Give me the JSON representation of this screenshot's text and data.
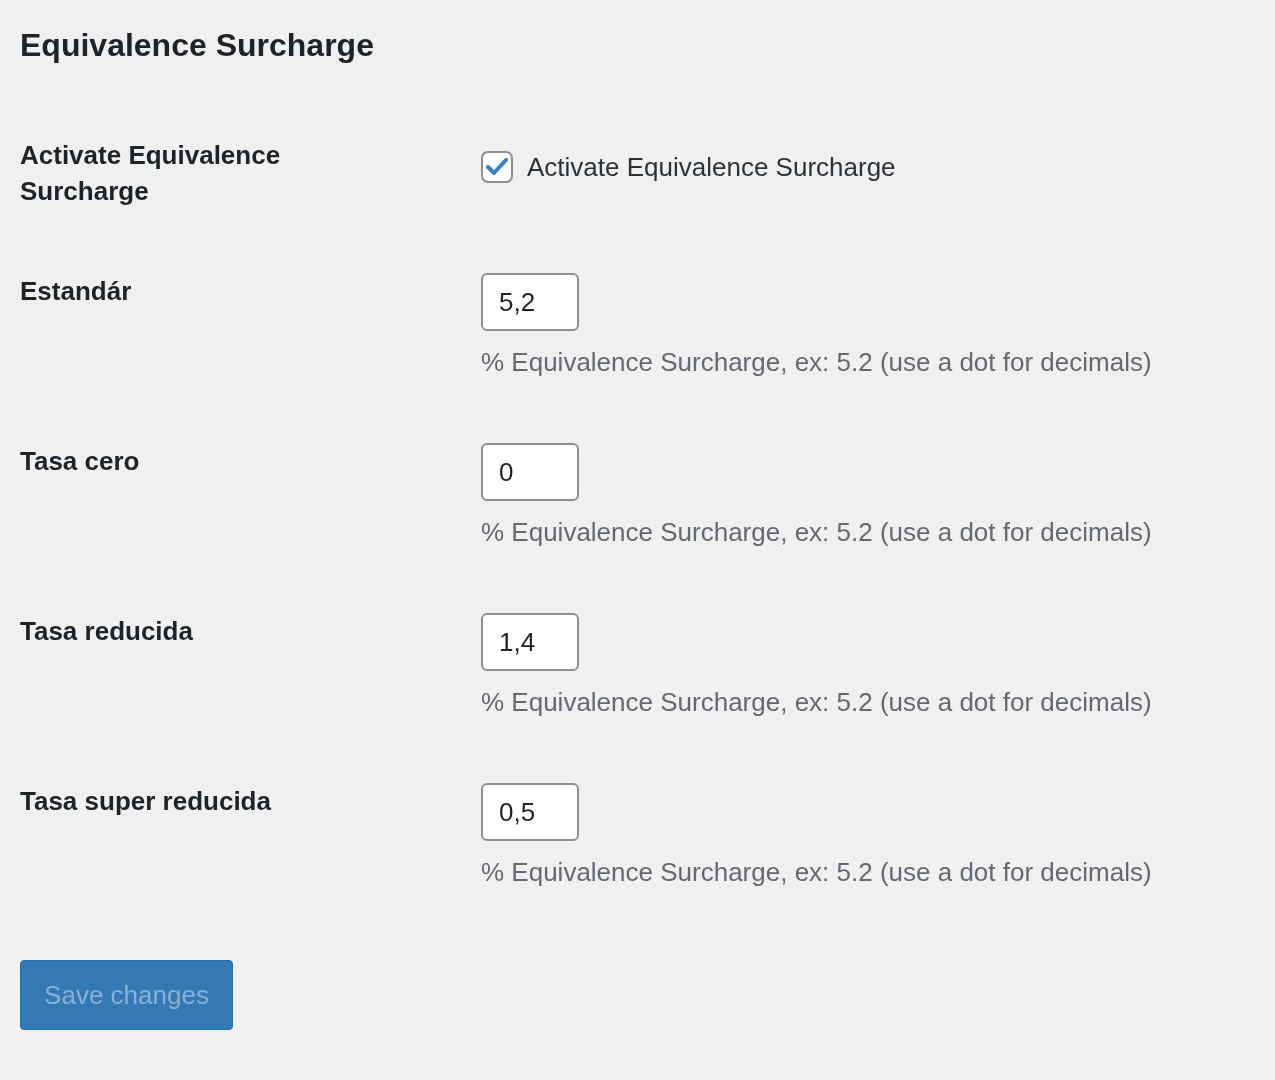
{
  "title": "Equivalence Surcharge",
  "settings": [
    {
      "kind": "checkbox",
      "label": "Activate Equivalence Surcharge",
      "option": "Activate Equivalence Surcharge",
      "checked": true
    },
    {
      "kind": "number",
      "label": "Estandár",
      "value": "5,2",
      "description": "% Equivalence Surcharge, ex: 5.2 (use a dot for decimals)"
    },
    {
      "kind": "number",
      "label": "Tasa cero",
      "value": "0",
      "description": "% Equivalence Surcharge, ex: 5.2 (use a dot for decimals)"
    },
    {
      "kind": "number",
      "label": "Tasa reducida",
      "value": "1,4",
      "description": "% Equivalence Surcharge, ex: 5.2 (use a dot for decimals)"
    },
    {
      "kind": "number",
      "label": "Tasa super reducida",
      "value": "0,5",
      "description": "% Equivalence Surcharge, ex: 5.2 (use a dot for decimals)"
    }
  ],
  "save_button": {
    "label": "Save changes",
    "disabled": true
  }
}
